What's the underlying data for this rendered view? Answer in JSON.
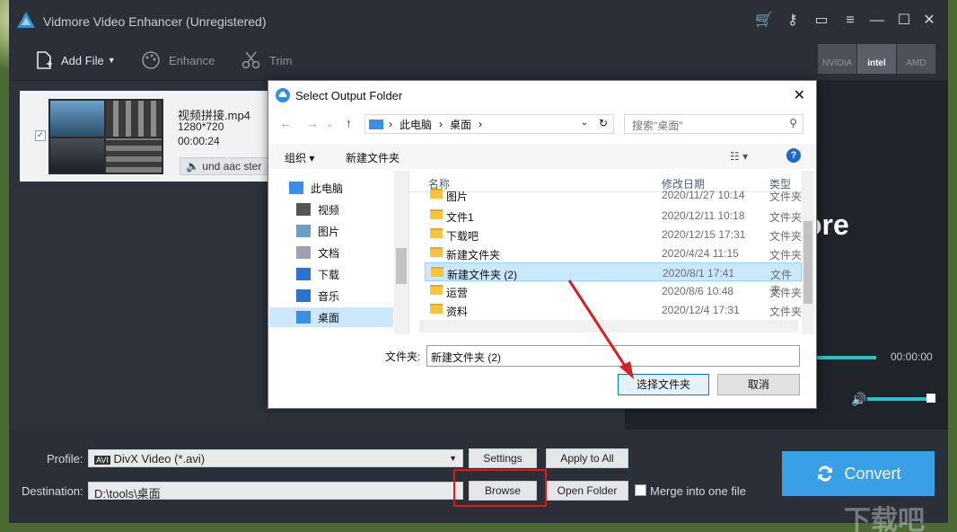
{
  "app": {
    "title": "Vidmore Video Enhancer (Unregistered)",
    "brand_partial": "ore"
  },
  "toolbar": {
    "add_file": "Add File",
    "enhance": "Enhance",
    "trim": "Trim",
    "hw_nvidia": "NVIDIA",
    "hw_intel": "intel",
    "hw_amd": "AMD"
  },
  "file": {
    "name": "视频拼接.mp4",
    "resolution": "1280*720",
    "duration": "00:00:24",
    "audio": "und aac ster"
  },
  "player": {
    "time": "00:00:00"
  },
  "bottom": {
    "profile_label": "Profile:",
    "profile_value": "DivX Video (*.avi)",
    "settings": "Settings",
    "apply_all": "Apply to All",
    "destination_label": "Destination:",
    "destination_value": "D:\\tools\\桌面",
    "browse": "Browse",
    "open_folder": "Open Folder",
    "merge": "Merge into one file",
    "convert": "Convert"
  },
  "dialog": {
    "title": "Select Output Folder",
    "breadcrumb": [
      "此电脑",
      "桌面"
    ],
    "search_placeholder": "搜索\"桌面\"",
    "organize": "组织 ▾",
    "new_folder": "新建文件夹",
    "nav": [
      {
        "label": "此电脑"
      },
      {
        "label": "视频"
      },
      {
        "label": "图片"
      },
      {
        "label": "文档"
      },
      {
        "label": "下载"
      },
      {
        "label": "音乐"
      },
      {
        "label": "桌面"
      }
    ],
    "columns": {
      "name": "名称",
      "date": "修改日期",
      "type": "类型"
    },
    "rows": [
      {
        "name": "图片",
        "date": "2020/11/27 10:14",
        "type": "文件夹"
      },
      {
        "name": "文件1",
        "date": "2020/12/11 10:18",
        "type": "文件夹"
      },
      {
        "name": "下载吧",
        "date": "2020/12/15 17:31",
        "type": "文件夹"
      },
      {
        "name": "新建文件夹",
        "date": "2020/4/24 11:15",
        "type": "文件夹"
      },
      {
        "name": "新建文件夹 (2)",
        "date": "2020/8/1 17:41",
        "type": "文件夹"
      },
      {
        "name": "运营",
        "date": "2020/8/6 10:48",
        "type": "文件夹"
      },
      {
        "name": "资料",
        "date": "2020/12/4 17:31",
        "type": "文件夹"
      }
    ],
    "folder_label": "文件夹:",
    "folder_value": "新建文件夹 (2)",
    "ok": "选择文件夹",
    "cancel": "取消"
  }
}
